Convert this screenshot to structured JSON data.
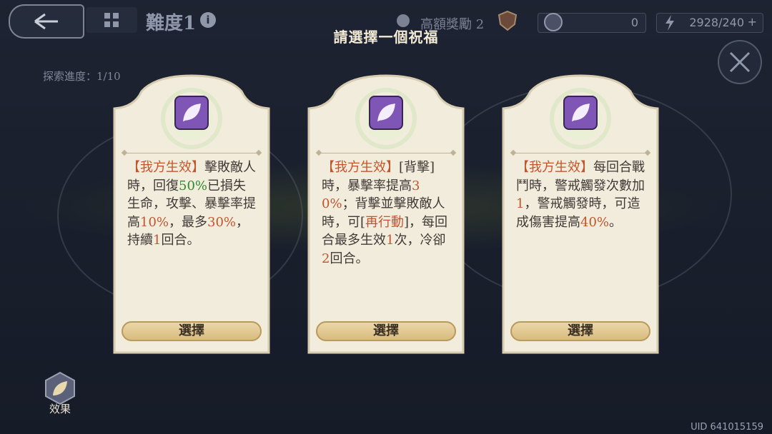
{
  "header": {
    "title": "難度1",
    "info_icon": "i",
    "high_reward_label": "高額獎勵 2",
    "coin_value": "0",
    "energy_value": "2928/240",
    "energy_plus": "+"
  },
  "progress": {
    "label": "探索進度：",
    "value": "1/10"
  },
  "dialog": {
    "heading": "請選擇一個祝福"
  },
  "cards": [
    {
      "icon": "leaf-icon",
      "tag": "【我方生效】",
      "p1": "擊敗敵人時，回復",
      "v1": "50%",
      "p2": "已損失生命，攻擊、暴擊率提高",
      "v2": "10%",
      "p3": "，最多",
      "v3": "30%",
      "p4": "，持續",
      "v4": "1",
      "p5": "回合。",
      "button": "選擇"
    },
    {
      "icon": "leaf-icon",
      "tag": "【我方生效】",
      "p1": "[背擊]時，暴擊率提高",
      "v1": "30%",
      "p2": "；背擊並擊敗敵人時，可[",
      "v2": "再行動",
      "p3": "]，每回合最多生效",
      "v3": "1",
      "p4": "次，冷卻",
      "v4": "2",
      "p5": "回合。",
      "button": "選擇"
    },
    {
      "icon": "leaf-icon",
      "tag": "【我方生效】",
      "p1": "每回合戰鬥時，警戒觸發次數加",
      "v1": "1",
      "p2": "，警戒觸發時，可造成傷害提高",
      "v2": "40%",
      "p3": "。",
      "v3": "",
      "p4": "",
      "v4": "",
      "p5": "",
      "button": "選擇"
    }
  ],
  "effect": {
    "label": "效果"
  },
  "footer": {
    "uid": "UID 641015159"
  },
  "colors": {
    "highlight": "#c0562e",
    "green": "#2f8a2e",
    "card_bg": "#f2ecdd",
    "icon_purple": "#7f55b5"
  }
}
